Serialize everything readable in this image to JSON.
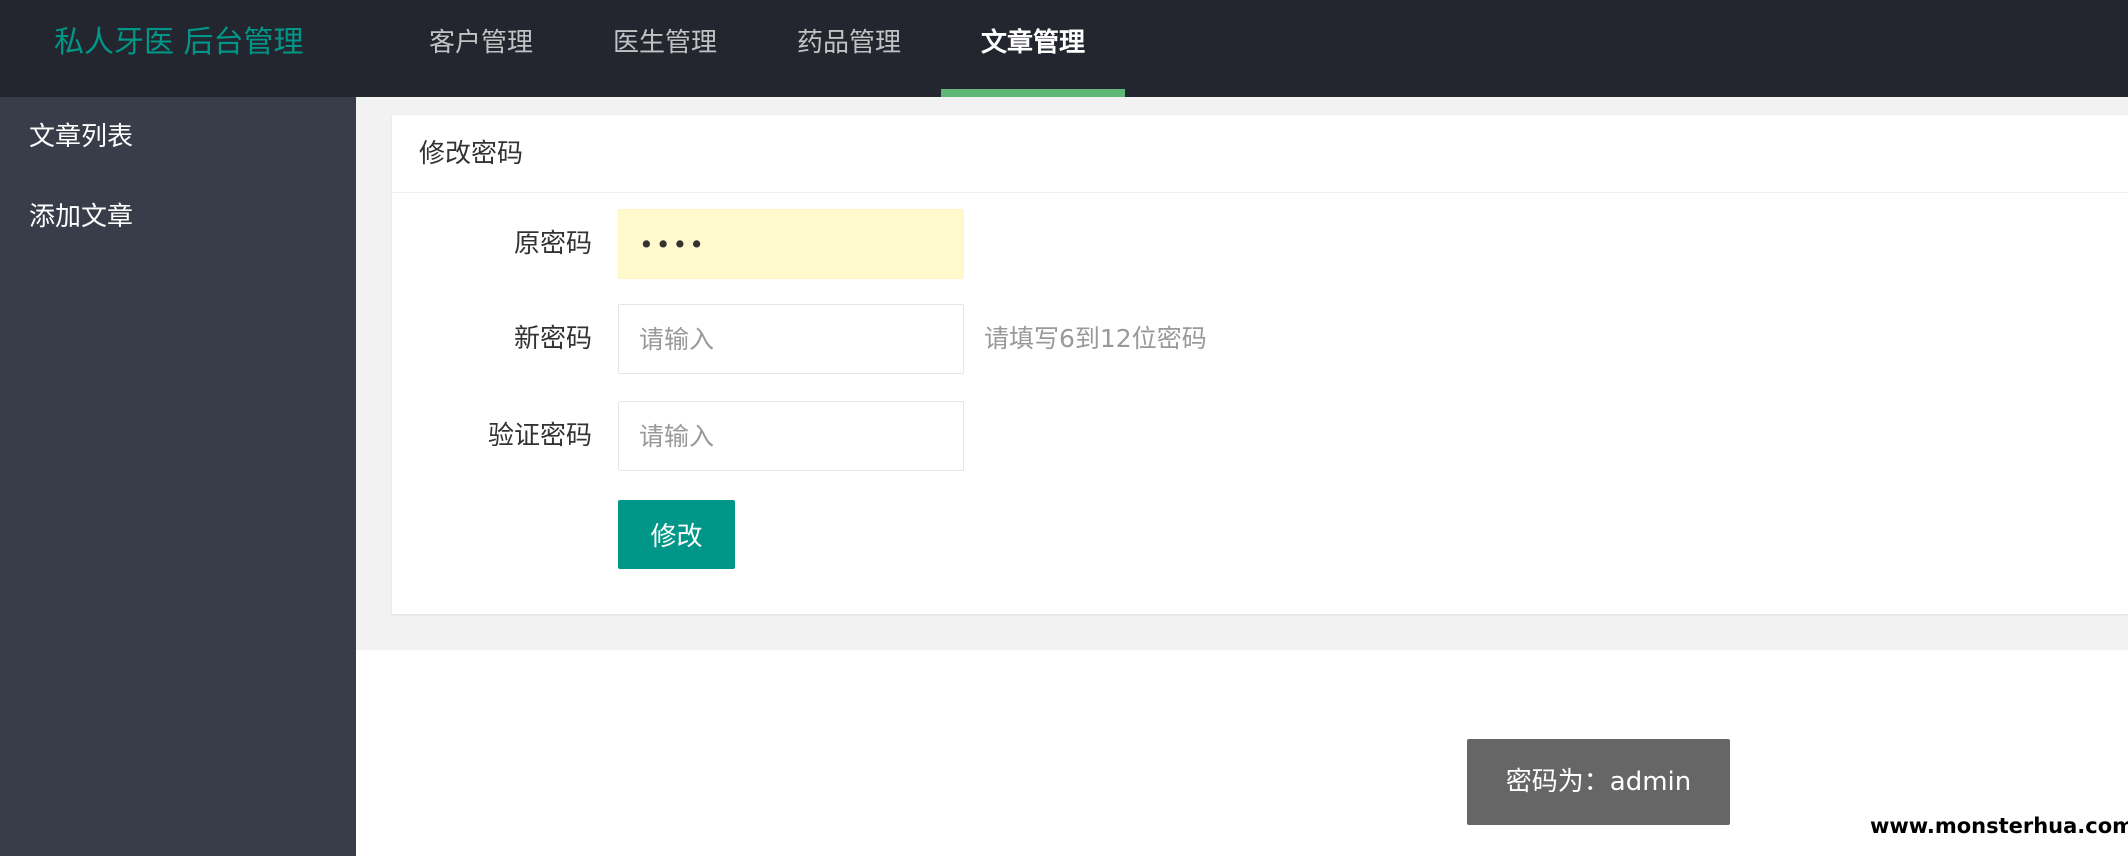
{
  "header": {
    "logo": "私人牙医 后台管理",
    "nav": [
      {
        "label": "客户管理",
        "active": false
      },
      {
        "label": "医生管理",
        "active": false
      },
      {
        "label": "药品管理",
        "active": false
      },
      {
        "label": "文章管理",
        "active": true
      }
    ]
  },
  "sidebar": {
    "items": [
      {
        "label": "文章列表"
      },
      {
        "label": "添加文章"
      }
    ]
  },
  "form": {
    "title": "修改密码",
    "old_password": {
      "label": "原密码",
      "value": "••••"
    },
    "new_password": {
      "label": "新密码",
      "placeholder": "请输入",
      "hint": "请填写6到12位密码"
    },
    "confirm_password": {
      "label": "验证密码",
      "placeholder": "请输入"
    },
    "submit_label": "修改"
  },
  "toast": {
    "text": "密码为：admin"
  },
  "watermark": {
    "text": "www.monsterhua.com"
  },
  "colors": {
    "header_bg": "#23262e",
    "sidebar_bg": "#393d49",
    "brand": "#009688",
    "nav_active_bar": "#5fb878",
    "toast_bg": "#666666",
    "autofill_bg": "#fffacd"
  }
}
